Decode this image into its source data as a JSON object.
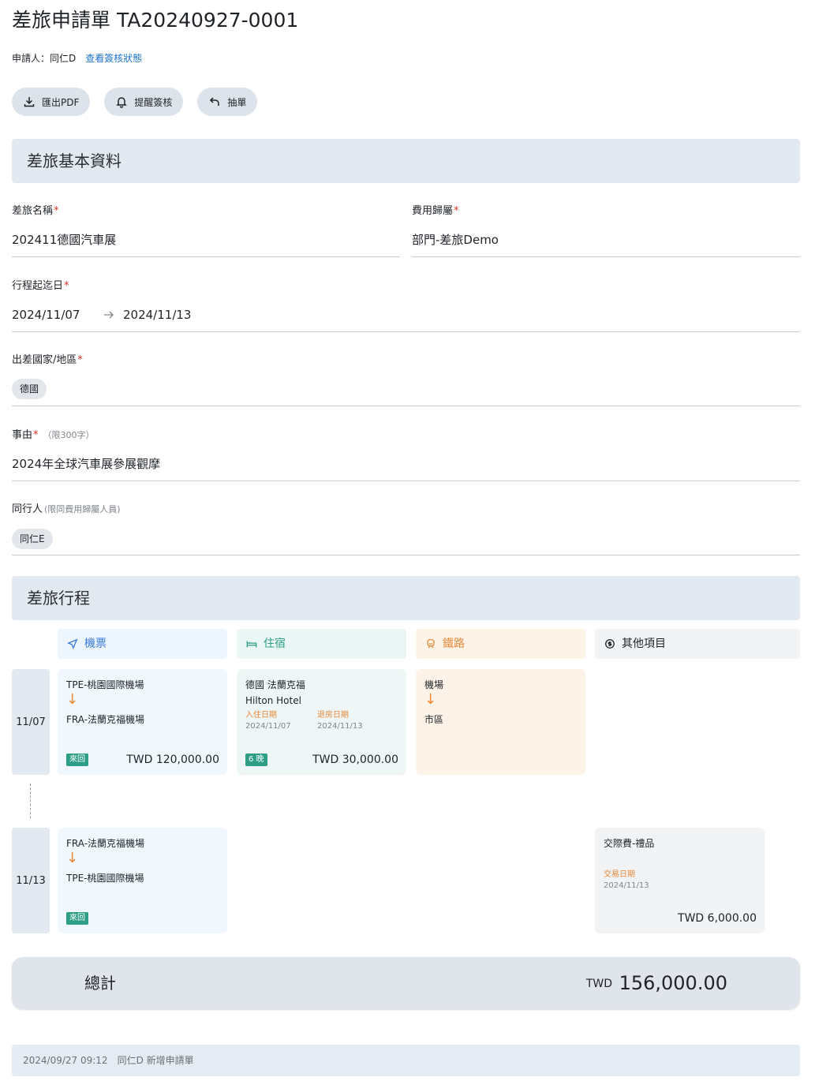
{
  "header": {
    "title": "差旅申請單 TA20240927-0001",
    "applicant": "申請人：同仁D",
    "view_status_link": "查看簽核狀態"
  },
  "actions": [
    {
      "label": "匯出PDF",
      "icon": "download-icon"
    },
    {
      "label": "提醒簽核",
      "icon": "bell-icon"
    },
    {
      "label": "抽單",
      "icon": "undo-icon"
    }
  ],
  "basic": {
    "section_title": "差旅基本資料",
    "trip_name_label": "差旅名稱",
    "trip_name_value": "202411德國汽車展",
    "cost_owner_label": "費用歸屬",
    "cost_owner_value": "部門-差旅Demo",
    "dates_label": "行程起迄日",
    "start_date": "2024/11/07",
    "end_date": "2024/11/13",
    "country_label": "出差國家/地區",
    "country_chip": "德國",
    "reason_label": "事由",
    "reason_hint": "（限300字）",
    "reason_value": "2024年全球汽車展參展觀摩",
    "companion_label": "同行人",
    "companion_hint": "(限同費用歸屬人員)",
    "companion_chip": "同仁E",
    "required_mark": "*"
  },
  "itinerary": {
    "section_title": "差旅行程",
    "columns": {
      "flight": "機票",
      "hotel": "住宿",
      "rail": "鐵路",
      "other": "其他項目"
    },
    "days": [
      {
        "date": "11/07"
      },
      {
        "date": "11/13"
      }
    ],
    "flight_out": {
      "from": "TPE-桃園國際機場",
      "to": "FRA-法蘭克福機場",
      "badge": "來回",
      "amount": "TWD 120,000.00"
    },
    "flight_back": {
      "from": "FRA-法蘭克福機場",
      "to": "TPE-桃園國際機場",
      "badge": "來回"
    },
    "hotel": {
      "location": "德國 法蘭克福",
      "name": "Hilton Hotel",
      "checkin_label": "入住日期",
      "checkin": "2024/11/07",
      "checkout_label": "退房日期",
      "checkout": "2024/11/13",
      "badge": "6 晚",
      "amount": "TWD 30,000.00"
    },
    "rail": {
      "from": "機場",
      "to": "市區"
    },
    "other": {
      "item": "交際費-禮品",
      "date_label": "交易日期",
      "date": "2024/11/13",
      "amount": "TWD 6,000.00"
    },
    "down_arrow": "↓"
  },
  "total": {
    "label": "總計",
    "currency": "TWD",
    "amount": "156,000.00"
  },
  "log": {
    "time": "2024/09/27 09:12",
    "text": "同仁D 新增申請單"
  },
  "colors": {
    "flight": "#3a7bd5",
    "hotel": "#2e9e86",
    "rail": "#e8883a",
    "badge": "#2e9e86"
  }
}
